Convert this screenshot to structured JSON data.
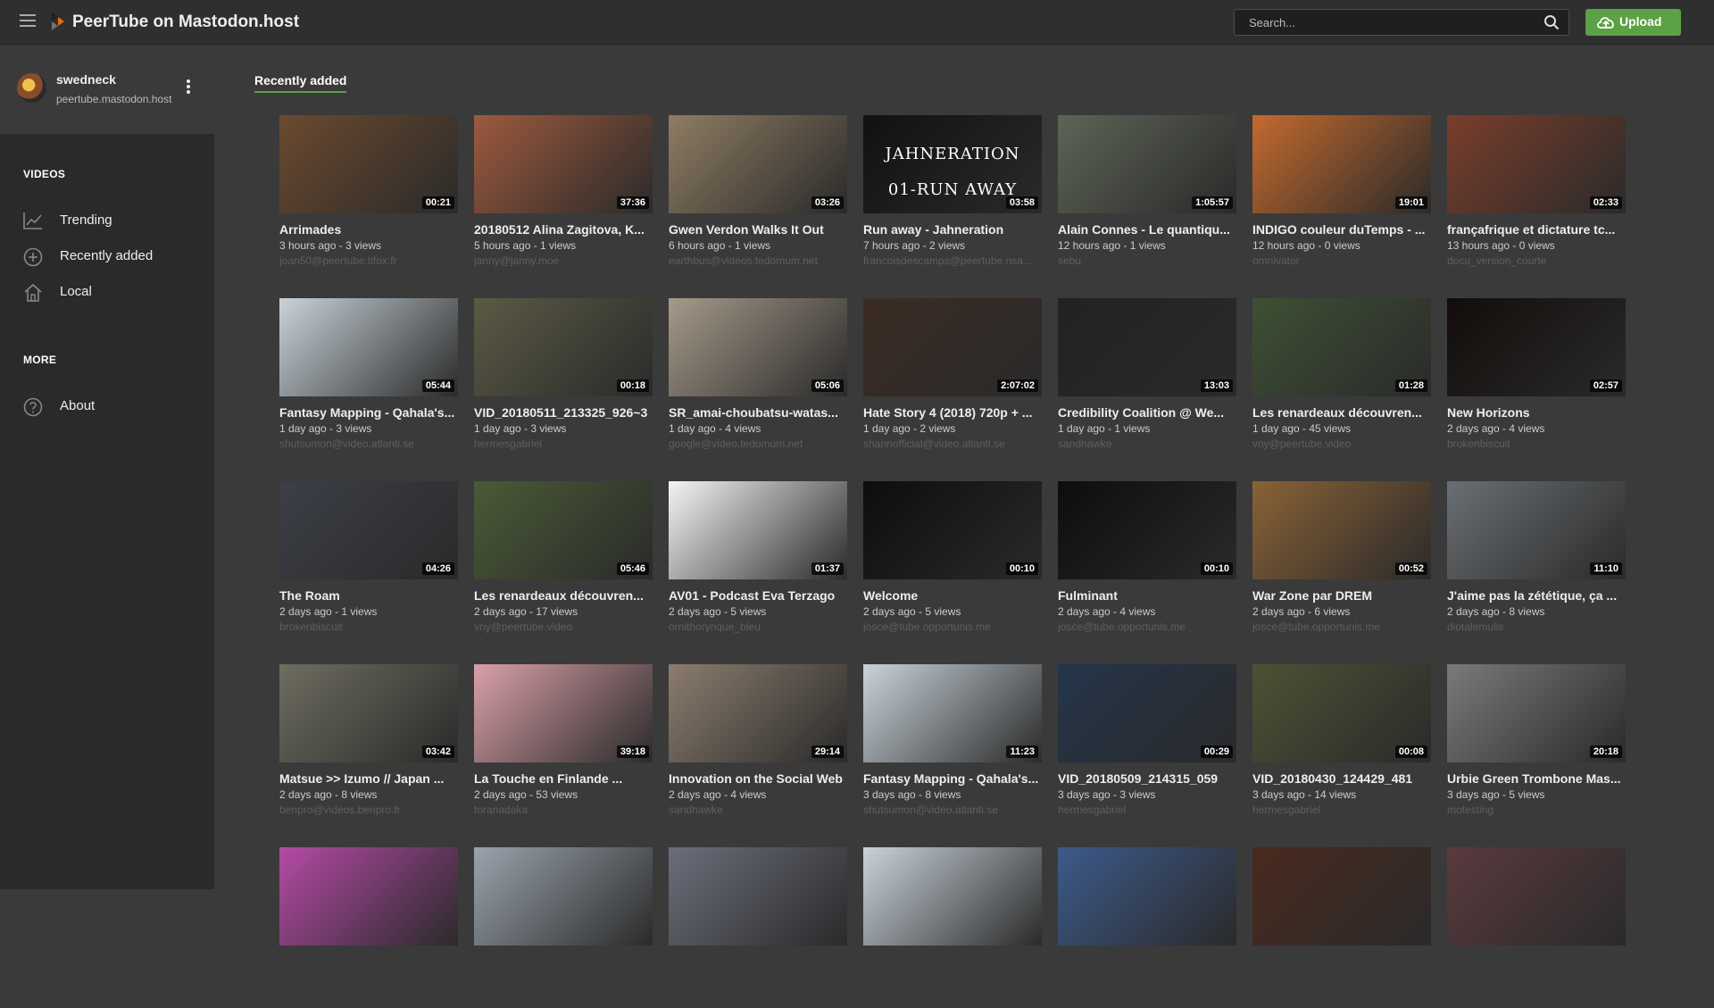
{
  "header": {
    "site_title": "PeerTube on Mastodon.host",
    "search_placeholder": "Search...",
    "upload_label": "Upload"
  },
  "user": {
    "name": "swedneck",
    "host": "peertube.mastodon.host"
  },
  "sidebar": {
    "videos_title": "VIDEOS",
    "more_title": "MORE",
    "items": [
      {
        "label": "Trending",
        "icon": "trending-icon"
      },
      {
        "label": "Recently added",
        "icon": "plus-circle-icon"
      },
      {
        "label": "Local",
        "icon": "home-icon"
      }
    ],
    "more_items": [
      {
        "label": "About",
        "icon": "help-icon"
      }
    ]
  },
  "page": {
    "tab_title": "Recently added"
  },
  "videos": [
    {
      "title": "Arrimades",
      "meta": "3 hours ago - 3 views",
      "account": "joan50@peertube.tifox.fr",
      "duration": "00:21",
      "color": "#6b4a2f"
    },
    {
      "title": "20180512 Alina Zagitova, K...",
      "meta": "5 hours ago - 1 views",
      "account": "janny@janny.moe",
      "duration": "37:36",
      "color": "#9c5a3e"
    },
    {
      "title": "Gwen Verdon Walks It Out",
      "meta": "6 hours ago - 1 views",
      "account": "earthbus@videos.tedomum.net",
      "duration": "03:26",
      "color": "#8f7d63"
    },
    {
      "title": "Run away - Jahneration",
      "meta": "7 hours ago - 2 views",
      "account": "francoisdescamps@peertube.nsa...",
      "duration": "03:58",
      "color": "#111111",
      "caption": "JAHNERATION 01-RUN AWAY"
    },
    {
      "title": "Alain Connes - Le quantiqu...",
      "meta": "12 hours ago - 1 views",
      "account": "sebu",
      "duration": "1:05:57",
      "color": "#5d6456"
    },
    {
      "title": "INDIGO couleur duTemps - ...",
      "meta": "12 hours ago - 0 views",
      "account": "omnivator",
      "duration": "19:01",
      "color": "#c46a2e"
    },
    {
      "title": "françafrique et dictature tc...",
      "meta": "13 hours ago - 0 views",
      "account": "docu_version_courte",
      "duration": "02:33",
      "color": "#7a3e2b"
    },
    {
      "title": "Fantasy Mapping - Qahala's...",
      "meta": "1 day ago - 3 views",
      "account": "shutsumon@video.atlanti.se",
      "duration": "05:44",
      "color": "#c9d3da"
    },
    {
      "title": "VID_20180511_213325_926~3",
      "meta": "1 day ago - 3 views",
      "account": "hermesgabriel",
      "duration": "00:18",
      "color": "#5b5a45"
    },
    {
      "title": "SR_amai-choubatsu-watas...",
      "meta": "1 day ago - 4 views",
      "account": "google@video.tedomum.net",
      "duration": "05:06",
      "color": "#a69a8a"
    },
    {
      "title": "Hate Story 4 (2018) 720p + ...",
      "meta": "1 day ago - 2 views",
      "account": "shannofficial@video.atlanti.se",
      "duration": "2:07:02",
      "color": "#3b2c24"
    },
    {
      "title": "Credibility Coalition @ We...",
      "meta": "1 day ago - 1 views",
      "account": "sandhawke",
      "duration": "13:03",
      "color": "#222222"
    },
    {
      "title": "Les renardeaux découvren...",
      "meta": "1 day ago - 45 views",
      "account": "vny@peertube.video",
      "duration": "01:28",
      "color": "#3e5034"
    },
    {
      "title": "New Horizons",
      "meta": "2 days ago - 4 views",
      "account": "brokenbiscuit",
      "duration": "02:57",
      "color": "#120d0b"
    },
    {
      "title": "The Roam",
      "meta": "2 days ago - 1 views",
      "account": "brokenbiscuit",
      "duration": "04:26",
      "color": "#3c3f47"
    },
    {
      "title": "Les renardeaux découvren...",
      "meta": "2 days ago - 17 views",
      "account": "vny@peertube.video",
      "duration": "05:46",
      "color": "#4a5a36"
    },
    {
      "title": "AV01 - Podcast Eva Terzago",
      "meta": "2 days ago - 5 views",
      "account": "ornithorynque_bleu",
      "duration": "01:37",
      "color": "#f4f4f4"
    },
    {
      "title": "Welcome",
      "meta": "2 days ago - 5 views",
      "account": "josce@tube.opportunis.me",
      "duration": "00:10",
      "color": "#0d0d0d"
    },
    {
      "title": "Fulminant",
      "meta": "2 days ago - 4 views",
      "account": "josce@tube.opportunis.me",
      "duration": "00:10",
      "color": "#0d0d0d"
    },
    {
      "title": "War Zone par DREM",
      "meta": "2 days ago - 6 views",
      "account": "josce@tube.opportunis.me",
      "duration": "00:52",
      "color": "#8a6236"
    },
    {
      "title": "J'aime pas la zététique, ça ...",
      "meta": "2 days ago - 8 views",
      "account": "diotalemulis",
      "duration": "11:10",
      "color": "#6a6f73"
    },
    {
      "title": "Matsue >> Izumo // Japan ...",
      "meta": "2 days ago - 8 views",
      "account": "benpro@videos.benpro.fr",
      "duration": "03:42",
      "color": "#6e6d60"
    },
    {
      "title": "La Touche en Finlande ...",
      "meta": "2 days ago - 53 views",
      "account": "toranadaka",
      "duration": "39:18",
      "color": "#d9a0a8"
    },
    {
      "title": "Innovation on the Social Web",
      "meta": "2 days ago - 4 views",
      "account": "sandhawke",
      "duration": "29:14",
      "color": "#8b7d6e"
    },
    {
      "title": "Fantasy Mapping - Qahala's...",
      "meta": "3 days ago - 8 views",
      "account": "shutsumon@video.atlanti.se",
      "duration": "11:23",
      "color": "#c9d3da"
    },
    {
      "title": "VID_20180509_214315_059",
      "meta": "3 days ago - 3 views",
      "account": "hermesgabriel",
      "duration": "00:29",
      "color": "#24354a"
    },
    {
      "title": "VID_20180430_124429_481",
      "meta": "3 days ago - 14 views",
      "account": "hermesgabriel",
      "duration": "00:08",
      "color": "#4c5234"
    },
    {
      "title": "Urbie Green Trombone Mas...",
      "meta": "3 days ago - 5 views",
      "account": "motesting",
      "duration": "20:18",
      "color": "#7a7a7a"
    },
    {
      "title": "",
      "meta": "",
      "account": "",
      "duration": "",
      "color": "#b44aa5"
    },
    {
      "title": "",
      "meta": "",
      "account": "",
      "duration": "",
      "color": "#9aa3ad"
    },
    {
      "title": "",
      "meta": "",
      "account": "",
      "duration": "",
      "color": "#6a6e7a"
    },
    {
      "title": "",
      "meta": "",
      "account": "",
      "duration": "",
      "color": "#c9d3da"
    },
    {
      "title": "",
      "meta": "",
      "account": "",
      "duration": "",
      "color": "#3c5a8a"
    },
    {
      "title": "",
      "meta": "",
      "account": "",
      "duration": "",
      "color": "#4a2a1f"
    },
    {
      "title": "",
      "meta": "",
      "account": "",
      "duration": "",
      "color": "#5a3a3e"
    }
  ]
}
